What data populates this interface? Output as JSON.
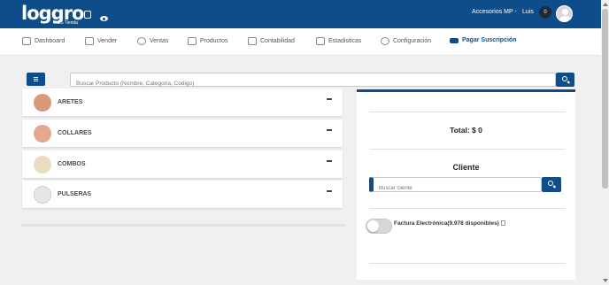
{
  "header": {
    "logo_text": "loggro",
    "logo_badge": "POS",
    "logo_sub": "POS Tienda",
    "store": "Accesorios MP -",
    "user": "Luis",
    "notifications": "0",
    "icons": {
      "visibility": "eye-icon",
      "avatar": "user-avatar"
    }
  },
  "nav": {
    "items": [
      {
        "label": "Dashboard",
        "icon": "dashboard-icon"
      },
      {
        "label": "Vender",
        "icon": "cart-icon"
      },
      {
        "label": "Ventas",
        "icon": "dollar-icon"
      },
      {
        "label": "Productos",
        "icon": "basket-icon"
      },
      {
        "label": "Contabilidad",
        "icon": "book-icon"
      },
      {
        "label": "Estadisticas",
        "icon": "bar-chart-icon"
      },
      {
        "label": "Configuración",
        "icon": "gear-icon"
      },
      {
        "label": "Pagar Suscripción",
        "icon": "credit-card-icon"
      }
    ]
  },
  "product_search": {
    "placeholder": "Buscar Producto (Nombre, Categoria, Codigo)"
  },
  "categories": [
    {
      "label": "ARETES",
      "color": "#d99a7a"
    },
    {
      "label": "COLLARES",
      "color": "#e3a98e"
    },
    {
      "label": "COMBOS",
      "color": "#e9dcc0"
    },
    {
      "label": "PULSERAS",
      "color": "#e6e6e6"
    }
  ],
  "cart": {
    "total": "Total: $ 0",
    "client_title": "Cliente",
    "client_placeholder": "Buscar cliente",
    "factura_label": "Factura Electrónica(9.978 disponibles)"
  },
  "colors": {
    "primary": "#0f4c8a",
    "background": "#f0f0f0"
  }
}
